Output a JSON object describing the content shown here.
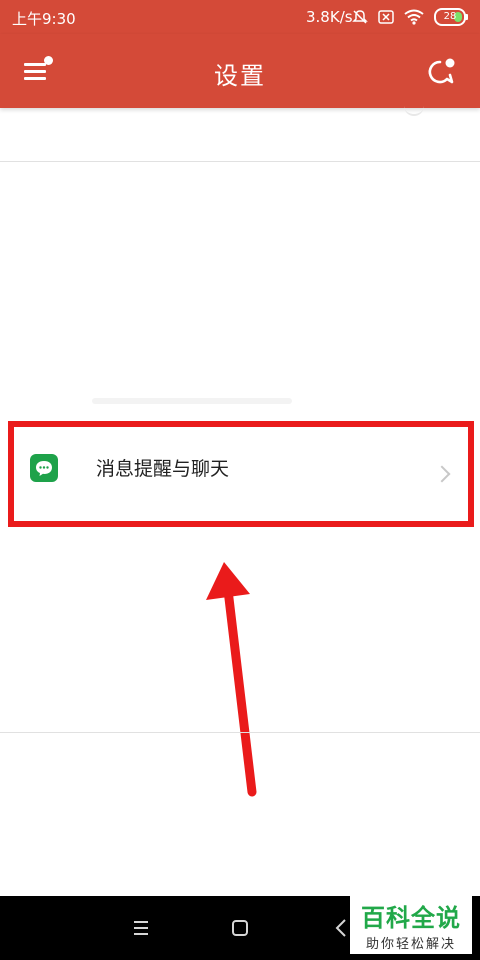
{
  "status_bar": {
    "time": "上午9:30",
    "net_speed": "3.8K/s",
    "battery_level": "28"
  },
  "app_bar": {
    "title": "设置"
  },
  "settings_row": {
    "label": "消息提醒与聊天"
  },
  "watermark": {
    "title": "百科全说",
    "subtitle": "助你轻松解决"
  },
  "colors": {
    "primary": "#d44a38",
    "highlight": "#ea1b1b",
    "icon_green": "#1ea24a"
  },
  "icons": [
    "menu-icon",
    "chat-icon",
    "message-icon",
    "chevron-right-icon",
    "mute-icon",
    "sim-icon",
    "wifi-icon",
    "battery-icon",
    "nav-menu-icon",
    "nav-home-icon",
    "nav-back-icon"
  ]
}
